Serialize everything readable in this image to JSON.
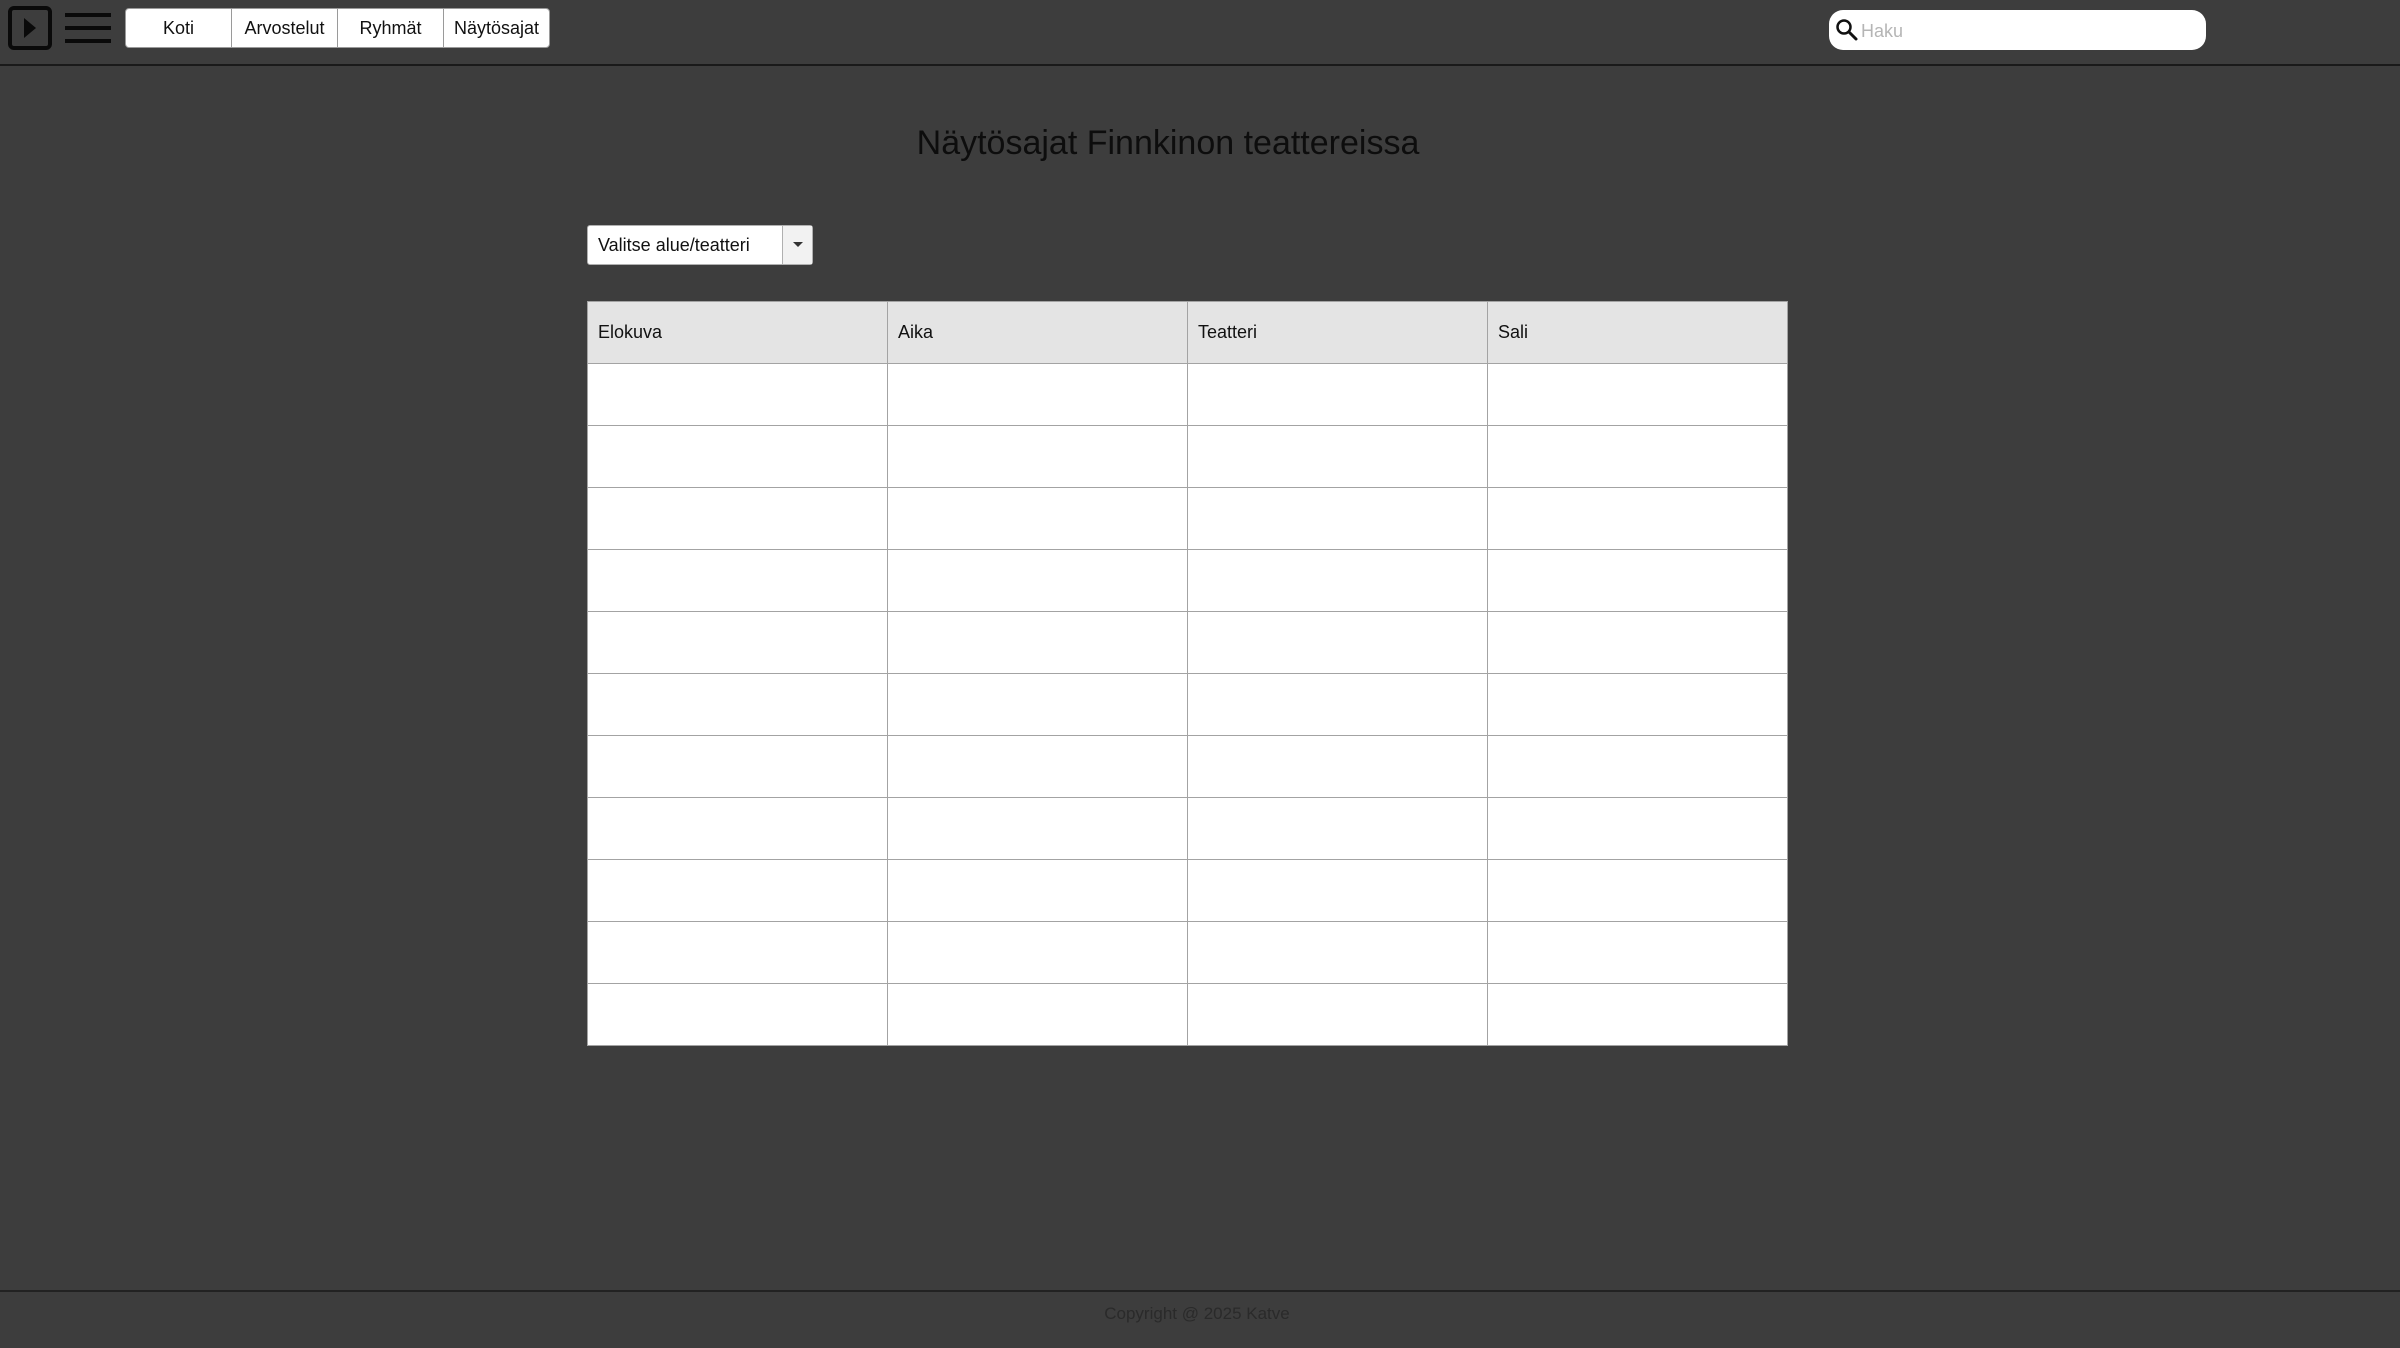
{
  "header": {
    "nav": [
      {
        "label": "Koti"
      },
      {
        "label": "Arvostelut"
      },
      {
        "label": "Ryhmät"
      },
      {
        "label": "Näytösajat"
      }
    ],
    "search": {
      "placeholder": "Haku",
      "value": ""
    },
    "icons": {
      "logo": "play-logo-icon",
      "menu": "hamburger-menu-icon",
      "search": "search-icon"
    }
  },
  "main": {
    "title": "Näytösajat Finnkinon teattereissa",
    "select": {
      "value": "Valitse alue/teatteri"
    },
    "table": {
      "columns": [
        "Elokuva",
        "Aika",
        "Teatteri",
        "Sali"
      ],
      "rows": [
        [
          "",
          "",
          "",
          ""
        ],
        [
          "",
          "",
          "",
          ""
        ],
        [
          "",
          "",
          "",
          ""
        ],
        [
          "",
          "",
          "",
          ""
        ],
        [
          "",
          "",
          "",
          ""
        ],
        [
          "",
          "",
          "",
          ""
        ],
        [
          "",
          "",
          "",
          ""
        ],
        [
          "",
          "",
          "",
          ""
        ],
        [
          "",
          "",
          "",
          ""
        ],
        [
          "",
          "",
          "",
          ""
        ],
        [
          "",
          "",
          "",
          ""
        ]
      ]
    }
  },
  "footer": {
    "text": "Copyright @ 2025 Katve"
  }
}
